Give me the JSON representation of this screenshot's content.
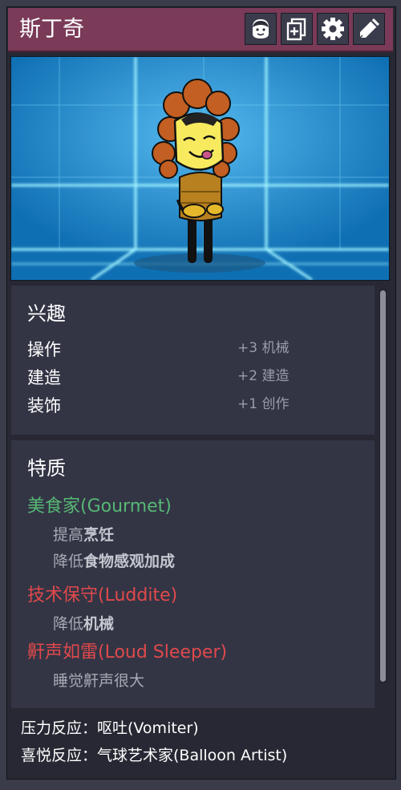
{
  "header": {
    "name": "斯丁奇",
    "buttons": [
      {
        "icon": "portrait-icon"
      },
      {
        "icon": "copy-icon"
      },
      {
        "icon": "gear-icon"
      },
      {
        "icon": "pencil-icon"
      }
    ],
    "color": "#7a3a58"
  },
  "interests": {
    "title": "兴趣",
    "rows": [
      {
        "label": "操作",
        "value": "+3 机械"
      },
      {
        "label": "建造",
        "value": "+2 建造"
      },
      {
        "label": "装饰",
        "value": "+1 创作"
      }
    ]
  },
  "traits": {
    "title": "特质",
    "items": [
      {
        "name": "美食家(Gourmet)",
        "color": "#56b874",
        "effects": [
          {
            "prefix": "提高",
            "bold": "烹饪"
          },
          {
            "prefix": "降低",
            "bold": "食物感观加成"
          }
        ]
      },
      {
        "name": "技术保守(Luddite)",
        "color": "#e0494b",
        "effects": [
          {
            "prefix": "降低",
            "bold": "机械"
          }
        ]
      },
      {
        "name": "鼾声如雷(Loud Sleeper)",
        "color": "#e0494b",
        "effects": [
          {
            "prefix": "睡觉鼾声很大",
            "bold": ""
          }
        ]
      }
    ]
  },
  "reactions": {
    "stress": "压力反应：呕吐(Vomiter)",
    "joy": "喜悦反应：气球艺术家(Balloon Artist)"
  }
}
